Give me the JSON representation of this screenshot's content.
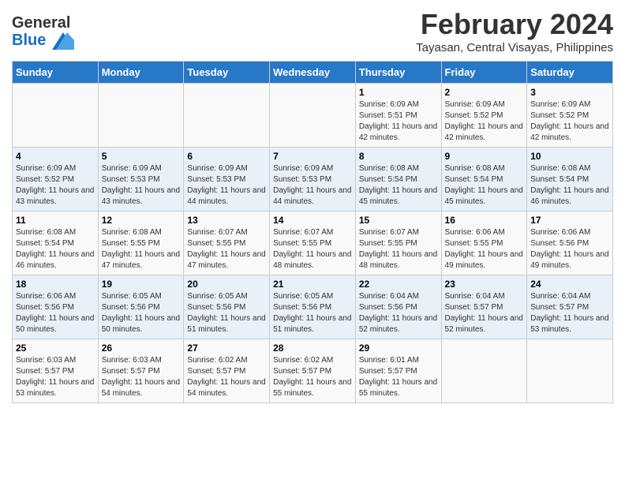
{
  "header": {
    "logo_general": "General",
    "logo_blue": "Blue",
    "title": "February 2024",
    "subtitle": "Tayasan, Central Visayas, Philippines"
  },
  "calendar": {
    "days_of_week": [
      "Sunday",
      "Monday",
      "Tuesday",
      "Wednesday",
      "Thursday",
      "Friday",
      "Saturday"
    ],
    "weeks": [
      [
        {
          "day": "",
          "sunrise": "",
          "sunset": "",
          "daylight": ""
        },
        {
          "day": "",
          "sunrise": "",
          "sunset": "",
          "daylight": ""
        },
        {
          "day": "",
          "sunrise": "",
          "sunset": "",
          "daylight": ""
        },
        {
          "day": "",
          "sunrise": "",
          "sunset": "",
          "daylight": ""
        },
        {
          "day": "1",
          "sunrise": "Sunrise: 6:09 AM",
          "sunset": "Sunset: 5:51 PM",
          "daylight": "Daylight: 11 hours and 42 minutes."
        },
        {
          "day": "2",
          "sunrise": "Sunrise: 6:09 AM",
          "sunset": "Sunset: 5:52 PM",
          "daylight": "Daylight: 11 hours and 42 minutes."
        },
        {
          "day": "3",
          "sunrise": "Sunrise: 6:09 AM",
          "sunset": "Sunset: 5:52 PM",
          "daylight": "Daylight: 11 hours and 42 minutes."
        }
      ],
      [
        {
          "day": "4",
          "sunrise": "Sunrise: 6:09 AM",
          "sunset": "Sunset: 5:52 PM",
          "daylight": "Daylight: 11 hours and 43 minutes."
        },
        {
          "day": "5",
          "sunrise": "Sunrise: 6:09 AM",
          "sunset": "Sunset: 5:53 PM",
          "daylight": "Daylight: 11 hours and 43 minutes."
        },
        {
          "day": "6",
          "sunrise": "Sunrise: 6:09 AM",
          "sunset": "Sunset: 5:53 PM",
          "daylight": "Daylight: 11 hours and 44 minutes."
        },
        {
          "day": "7",
          "sunrise": "Sunrise: 6:09 AM",
          "sunset": "Sunset: 5:53 PM",
          "daylight": "Daylight: 11 hours and 44 minutes."
        },
        {
          "day": "8",
          "sunrise": "Sunrise: 6:08 AM",
          "sunset": "Sunset: 5:54 PM",
          "daylight": "Daylight: 11 hours and 45 minutes."
        },
        {
          "day": "9",
          "sunrise": "Sunrise: 6:08 AM",
          "sunset": "Sunset: 5:54 PM",
          "daylight": "Daylight: 11 hours and 45 minutes."
        },
        {
          "day": "10",
          "sunrise": "Sunrise: 6:08 AM",
          "sunset": "Sunset: 5:54 PM",
          "daylight": "Daylight: 11 hours and 46 minutes."
        }
      ],
      [
        {
          "day": "11",
          "sunrise": "Sunrise: 6:08 AM",
          "sunset": "Sunset: 5:54 PM",
          "daylight": "Daylight: 11 hours and 46 minutes."
        },
        {
          "day": "12",
          "sunrise": "Sunrise: 6:08 AM",
          "sunset": "Sunset: 5:55 PM",
          "daylight": "Daylight: 11 hours and 47 minutes."
        },
        {
          "day": "13",
          "sunrise": "Sunrise: 6:07 AM",
          "sunset": "Sunset: 5:55 PM",
          "daylight": "Daylight: 11 hours and 47 minutes."
        },
        {
          "day": "14",
          "sunrise": "Sunrise: 6:07 AM",
          "sunset": "Sunset: 5:55 PM",
          "daylight": "Daylight: 11 hours and 48 minutes."
        },
        {
          "day": "15",
          "sunrise": "Sunrise: 6:07 AM",
          "sunset": "Sunset: 5:55 PM",
          "daylight": "Daylight: 11 hours and 48 minutes."
        },
        {
          "day": "16",
          "sunrise": "Sunrise: 6:06 AM",
          "sunset": "Sunset: 5:55 PM",
          "daylight": "Daylight: 11 hours and 49 minutes."
        },
        {
          "day": "17",
          "sunrise": "Sunrise: 6:06 AM",
          "sunset": "Sunset: 5:56 PM",
          "daylight": "Daylight: 11 hours and 49 minutes."
        }
      ],
      [
        {
          "day": "18",
          "sunrise": "Sunrise: 6:06 AM",
          "sunset": "Sunset: 5:56 PM",
          "daylight": "Daylight: 11 hours and 50 minutes."
        },
        {
          "day": "19",
          "sunrise": "Sunrise: 6:05 AM",
          "sunset": "Sunset: 5:56 PM",
          "daylight": "Daylight: 11 hours and 50 minutes."
        },
        {
          "day": "20",
          "sunrise": "Sunrise: 6:05 AM",
          "sunset": "Sunset: 5:56 PM",
          "daylight": "Daylight: 11 hours and 51 minutes."
        },
        {
          "day": "21",
          "sunrise": "Sunrise: 6:05 AM",
          "sunset": "Sunset: 5:56 PM",
          "daylight": "Daylight: 11 hours and 51 minutes."
        },
        {
          "day": "22",
          "sunrise": "Sunrise: 6:04 AM",
          "sunset": "Sunset: 5:56 PM",
          "daylight": "Daylight: 11 hours and 52 minutes."
        },
        {
          "day": "23",
          "sunrise": "Sunrise: 6:04 AM",
          "sunset": "Sunset: 5:57 PM",
          "daylight": "Daylight: 11 hours and 52 minutes."
        },
        {
          "day": "24",
          "sunrise": "Sunrise: 6:04 AM",
          "sunset": "Sunset: 5:57 PM",
          "daylight": "Daylight: 11 hours and 53 minutes."
        }
      ],
      [
        {
          "day": "25",
          "sunrise": "Sunrise: 6:03 AM",
          "sunset": "Sunset: 5:57 PM",
          "daylight": "Daylight: 11 hours and 53 minutes."
        },
        {
          "day": "26",
          "sunrise": "Sunrise: 6:03 AM",
          "sunset": "Sunset: 5:57 PM",
          "daylight": "Daylight: 11 hours and 54 minutes."
        },
        {
          "day": "27",
          "sunrise": "Sunrise: 6:02 AM",
          "sunset": "Sunset: 5:57 PM",
          "daylight": "Daylight: 11 hours and 54 minutes."
        },
        {
          "day": "28",
          "sunrise": "Sunrise: 6:02 AM",
          "sunset": "Sunset: 5:57 PM",
          "daylight": "Daylight: 11 hours and 55 minutes."
        },
        {
          "day": "29",
          "sunrise": "Sunrise: 6:01 AM",
          "sunset": "Sunset: 5:57 PM",
          "daylight": "Daylight: 11 hours and 55 minutes."
        },
        {
          "day": "",
          "sunrise": "",
          "sunset": "",
          "daylight": ""
        },
        {
          "day": "",
          "sunrise": "",
          "sunset": "",
          "daylight": ""
        }
      ]
    ]
  }
}
